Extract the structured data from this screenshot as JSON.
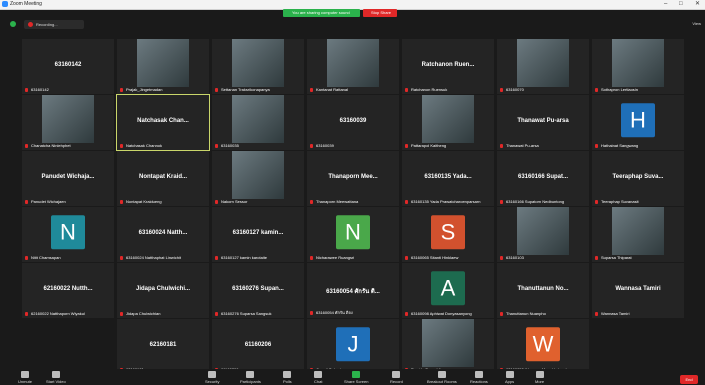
{
  "window": {
    "title": "Zoom Meeting",
    "min": "–",
    "max": "□",
    "close": "✕"
  },
  "share_banner": {
    "text": "You are sharing computer sound",
    "stop": "Stop Share"
  },
  "topbar": {
    "recording": "Recording...",
    "view": "View"
  },
  "colors": {
    "bg": "#1a1a1a",
    "tile": "#242424",
    "active": "#c9d66a",
    "end": "#e02828",
    "share": "#2bb24c"
  },
  "tiles": [
    {
      "center": "63160142",
      "label": "63160142"
    },
    {
      "photo": true,
      "label": "Prajak_Jingetmadan"
    },
    {
      "photo": true,
      "label": "Settanan Traksrikonapanya"
    },
    {
      "photo": true,
      "label": "Kantanat Rattanal"
    },
    {
      "center": "Ratchanon Ruen...",
      "label": "Ratchanon Ruensuk"
    },
    {
      "photo": true,
      "label": "63160070"
    },
    {
      "photo": true,
      "label": "Sothapron Lertlaosin"
    },
    {
      "photo": true,
      "label": "Chanatcha Ninlehphet"
    },
    {
      "center": "Natchasak Chan...",
      "label": "Natchasak Channok",
      "active": true
    },
    {
      "photo": true,
      "label": "63160035"
    },
    {
      "center": "63160039",
      "label": "63160039"
    },
    {
      "photo": true,
      "label": "Pattarapol Kaitheng"
    },
    {
      "center": "Thanawat Pu-arsa",
      "label": "Thanawat Pu-arsa"
    },
    {
      "avatar": "H",
      "avatar_color": "#1f6fb8",
      "label": "Hathainat Sangwang"
    },
    {
      "center": "Panudet Wichaja...",
      "label": "Panudet Wichajaen"
    },
    {
      "center": "Nontapat  Kraid...",
      "label": "Nontapat Kraidueng"
    },
    {
      "photo": true,
      "label": "Nakorn Sessor"
    },
    {
      "center": "Thanaporn Mee...",
      "label": "Thanaporn Meewattana"
    },
    {
      "center": "63160135 Yada...",
      "label": "63160135 Yada Prawatcharoenparsarn"
    },
    {
      "center": "63160166 Supat...",
      "label": "63160166 Supatorn Nedbuntong"
    },
    {
      "center": "Teeraphap Suva...",
      "label": "Teeraphap Suvanasit"
    },
    {
      "avatar": "N",
      "avatar_color": "#1f8a9a",
      "label": "Nitit Chamsapan"
    },
    {
      "center": "63160024 Natth...",
      "label": "63160024 Natthaphat Linwichit"
    },
    {
      "center": "63160127 kamin...",
      "label": "63160127 kamin karotaite"
    },
    {
      "avatar": "N",
      "avatar_color": "#4aa84a",
      "label": "Nicharawee Ruangsri"
    },
    {
      "avatar": "S",
      "avatar_color": "#d2512e",
      "label": "63160065 Sitanti Hinklaew"
    },
    {
      "photo": true,
      "label": "63160103"
    },
    {
      "photo": true,
      "label": "Suparsa Thiparat"
    },
    {
      "center": "62160022 Nutth...",
      "label": "62160022 Natthaporn Wiyakul"
    },
    {
      "center": "Jidapa  Chulwichi...",
      "label": "Jidapa Chulwichian"
    },
    {
      "center": "63160276 Supan...",
      "label": "63160276 Suparsa Sangsuk"
    },
    {
      "center": "63160054 ศักรัน ดิ...",
      "label": "63160054 ศักรัน ติจง"
    },
    {
      "avatar": "A",
      "avatar_color": "#1d6b4f",
      "label": "63160098 Aphiwat Donyasanyong"
    },
    {
      "center": "Thanuttanun  No...",
      "label": "Thanuttanun Nuanpho"
    },
    {
      "center": "Wannasa Tamiri",
      "label": "Wannasa Tamiri"
    },
    {
      "center": "62160181",
      "label": "62160181"
    },
    {
      "center": "61160206",
      "label": "61160206"
    },
    {
      "avatar": "J",
      "avatar_color": "#1f6fb8",
      "label": "Jiramit Suksai"
    },
    {
      "photo": true,
      "label": "Pawida Sawaddipoom"
    },
    {
      "avatar": "W",
      "avatar_color": "#e0612e",
      "label": "63160050 Waranya Mongkholsupha"
    }
  ],
  "toolbar": {
    "unmute": "Unmute",
    "start_video": "Start Video",
    "security": "Security",
    "participants": "Participants",
    "participants_count": "40",
    "polls": "Polls",
    "chat": "Chat",
    "share_screen": "Share Screen",
    "record": "Record",
    "breakout": "Breakout Rooms",
    "reactions": "Reactions",
    "apps": "Apps",
    "more": "More",
    "end": "End"
  }
}
